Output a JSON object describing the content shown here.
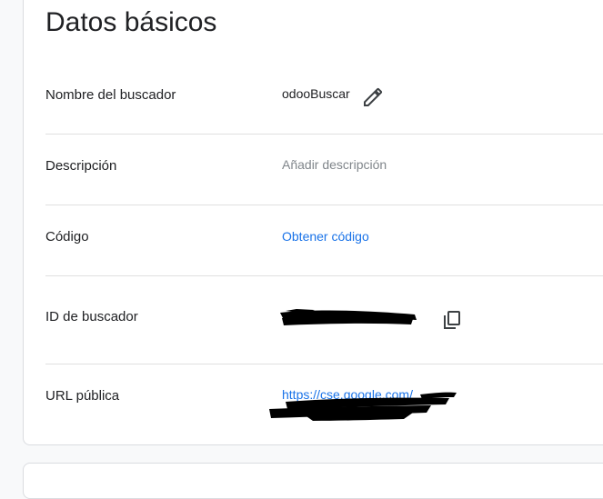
{
  "section": {
    "title": "Datos básicos"
  },
  "fields": {
    "name": {
      "label": "Nombre del buscador",
      "value": "odooBuscar"
    },
    "description": {
      "label": "Descripción",
      "placeholder": "Añadir descripción"
    },
    "code": {
      "label": "Código",
      "link": "Obtener código"
    },
    "search_id": {
      "label": "ID de buscador"
    },
    "public_url": {
      "label": "URL pública",
      "link": "https://cse.google.com/"
    }
  },
  "icons": {
    "edit": "pencil-icon",
    "copy": "copy-icon"
  },
  "colors": {
    "link": "#1a73e8",
    "muted": "#80868b",
    "text": "#202124",
    "divider": "#e0e0e0",
    "redaction": "#000000"
  }
}
